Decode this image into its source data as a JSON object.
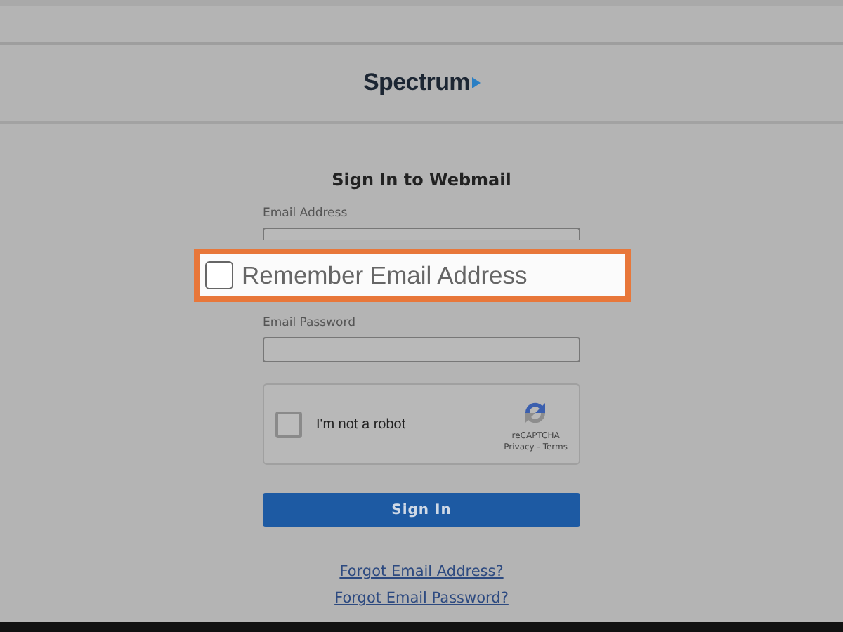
{
  "header": {
    "logo": "Spectrum"
  },
  "form": {
    "title": "Sign In to Webmail",
    "fields": [
      {
        "label": "Email Address"
      },
      {
        "label": "Email Password"
      }
    ],
    "captcha": {
      "label": "I'm not a robot",
      "checked": false,
      "brand": "reCAPTCHA",
      "links": "Privacy - Terms"
    },
    "submit": "Sign In",
    "links": [
      "Forgot Email Address?",
      "Forgot Email Password?"
    ]
  },
  "highlight": {
    "label": "Remember Email Address",
    "checked": false
  }
}
